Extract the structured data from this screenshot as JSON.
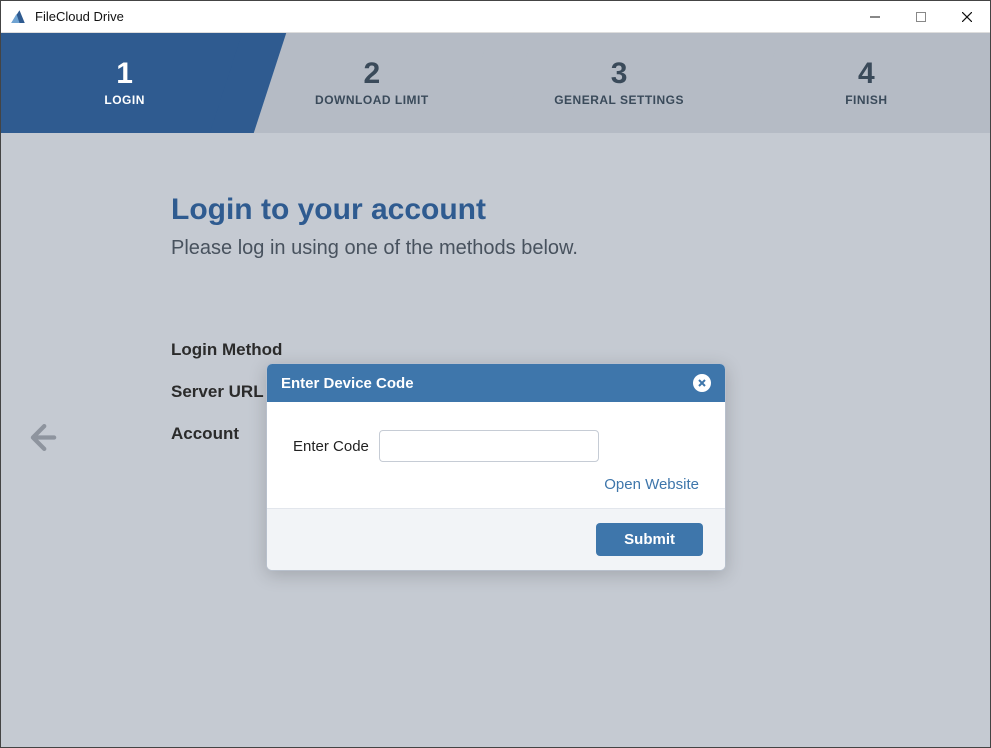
{
  "window": {
    "title": "FileCloud Drive"
  },
  "stepper": {
    "steps": [
      {
        "num": "1",
        "label": "LOGIN",
        "active": true
      },
      {
        "num": "2",
        "label": "DOWNLOAD LIMIT",
        "active": false
      },
      {
        "num": "3",
        "label": "GENERAL SETTINGS",
        "active": false
      },
      {
        "num": "4",
        "label": "FINISH",
        "active": false
      }
    ]
  },
  "page": {
    "heading": "Login to your account",
    "subtitle": "Please log in using one of the methods below.",
    "labels": {
      "login_method": "Login Method",
      "server_url": "Server URL",
      "account": "Account"
    }
  },
  "modal": {
    "title": "Enter Device Code",
    "enter_code_label": "Enter Code",
    "code_value": "",
    "open_website": "Open Website",
    "submit": "Submit"
  }
}
